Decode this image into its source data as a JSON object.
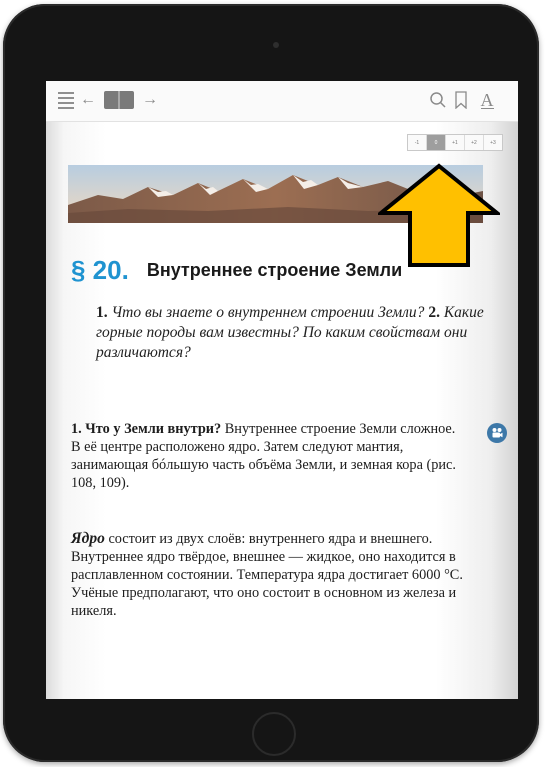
{
  "toolbar": {
    "icons": [
      "menu-icon",
      "back-arrow-icon",
      "book-icon",
      "forward-arrow-icon",
      "search-icon",
      "bookmark-icon",
      "font-size-icon"
    ],
    "back_glyph": "←",
    "forward_glyph": "→",
    "font_glyph": "A"
  },
  "zoom": {
    "levels": [
      "-1",
      "0",
      "+1",
      "+2",
      "+3"
    ],
    "selected": "0"
  },
  "section": {
    "number": "§ 20.",
    "title": "Внутреннее строение Земли"
  },
  "questions": {
    "q1_num": "1.",
    "q1_text": "Что вы знаете о внутреннем строении Земли?",
    "q2_num": "2.",
    "q2_text": "Какие горные породы вам известны? По каким свойствам они различаются?"
  },
  "paragraph1": {
    "heading": "1. Что у Земли внутри?",
    "text": "Внутреннее строение Земли сложное. В её центре расположено ядро. Затем следуют мантия, занимающая бóльшую часть объёма Земли, и земная кора (рис. 108, 109)."
  },
  "paragraph2": {
    "term": "Ядро",
    "text": "состоит из двух слоёв: внутреннего ядра и внешнего. Внутреннее ядро твёрдое, внешнее — жидкое, оно находится в расплавленном состоянии. Температура ядра достигает 6000 °С. Учёные предполагают, что оно состоит в основном из железа и никеля."
  },
  "colors": {
    "section_number": "#1f93d0",
    "arrow_fill": "#ffc000",
    "video_icon": "#3d78a8"
  }
}
